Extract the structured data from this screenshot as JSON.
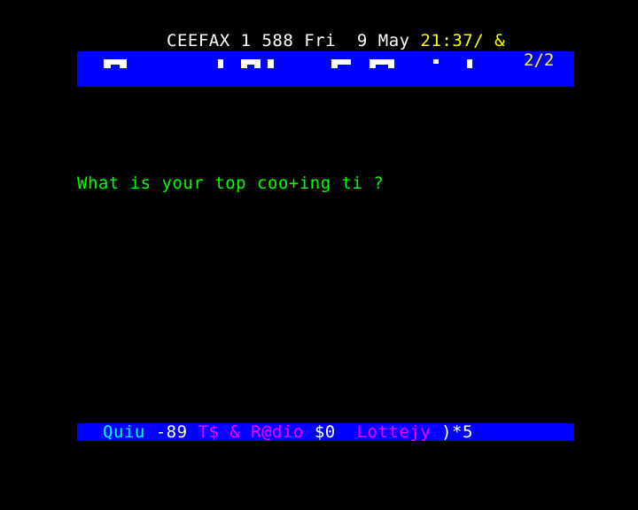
{
  "header": {
    "service": "CEEFAX 1 588 Fri  9 May ",
    "clock": "21:37/ &"
  },
  "banner": {
    "page_counter": "2/2",
    "graphic_name": "mosaic-title-graphic"
  },
  "body": {
    "question": "What is your top coo+ing ti ?"
  },
  "fastext": {
    "quiz_label": "Quiu ",
    "quiz_page": "-89 ",
    "tv_radio_label": "T$ & R@dio ",
    "tv_radio_page": "$0  ",
    "lottery_label": "Lottejy ",
    "lottery_page": ")*5"
  },
  "colors": {
    "background": "#000000",
    "banner": "#0000ff",
    "header_text": "#ffffff",
    "clock": "#ffff00",
    "question": "#00ff00",
    "quiz": "#00ffff",
    "tv_radio": "#ff00ff",
    "lottery": "#ff00ff"
  }
}
